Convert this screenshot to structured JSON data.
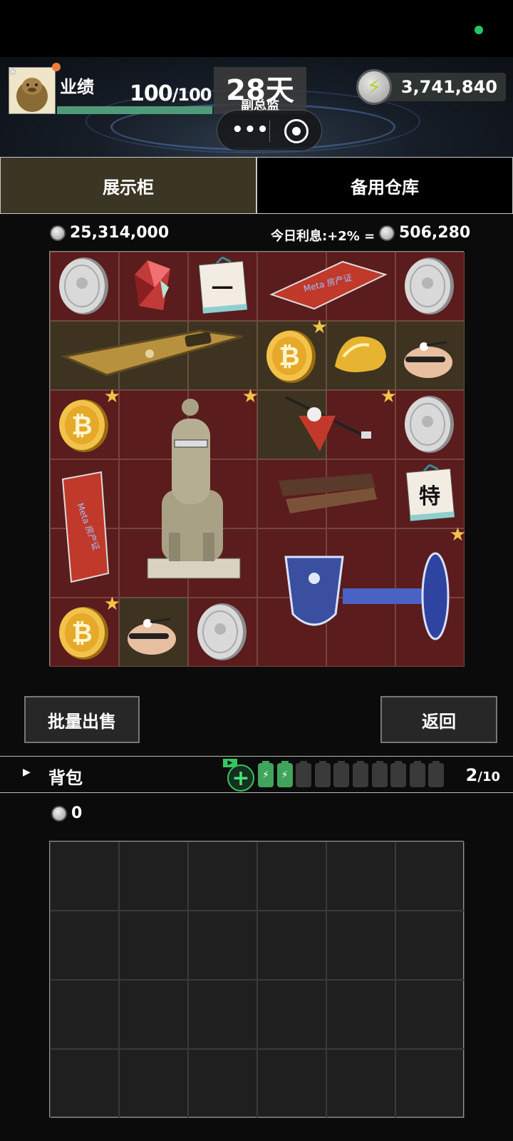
{
  "player": {
    "performance_label": "业绩",
    "performance_value": "100",
    "performance_max": "/100",
    "performance_fraction": 1.0,
    "days": "28天",
    "rank": "副总监",
    "money": "3,741,840"
  },
  "tabs": [
    {
      "label": "展示柜",
      "active": true
    },
    {
      "label": "备用仓库",
      "active": false
    }
  ],
  "showcase": {
    "total_value": "25,314,000",
    "interest_label": "今日利息:+2% =",
    "interest_value": "506,280"
  },
  "items": [
    {
      "name": "silver-coin",
      "label": "",
      "starred": false
    },
    {
      "name": "red-gem",
      "label": "",
      "starred": false
    },
    {
      "name": "notice-card",
      "label": "一",
      "starred": false
    },
    {
      "name": "meta-property-card",
      "label": "Meta 房产证",
      "starred": false
    },
    {
      "name": "silver-coin",
      "label": "",
      "starred": false
    },
    {
      "name": "gold-phone",
      "label": "",
      "starred": false
    },
    {
      "name": "bitcoin",
      "label": "₿",
      "starred": true
    },
    {
      "name": "gold-nugget",
      "label": "",
      "starred": false
    },
    {
      "name": "capsule-robot",
      "label": "",
      "starred": false
    },
    {
      "name": "bitcoin",
      "label": "₿",
      "starred": true
    },
    {
      "name": "alpaca-statue",
      "label": "",
      "starred": true
    },
    {
      "name": "red-spinning-top",
      "label": "",
      "starred": true
    },
    {
      "name": "silver-coin",
      "label": "",
      "starred": false
    },
    {
      "name": "meta-property-card",
      "label": "Meta 房产证",
      "starred": false
    },
    {
      "name": "wooden-ruler",
      "label": "",
      "starred": false
    },
    {
      "name": "special-card",
      "label": "特",
      "starred": false
    },
    {
      "name": "crystal-goblet",
      "label": "",
      "starred": true
    },
    {
      "name": "bitcoin",
      "label": "₿",
      "starred": true
    },
    {
      "name": "capsule-robot",
      "label": "",
      "starred": false
    },
    {
      "name": "silver-coin",
      "label": "",
      "starred": false
    }
  ],
  "buttons": {
    "bulk_sell": "批量出售",
    "back": "返回"
  },
  "backpack": {
    "title": "背包",
    "count": "2",
    "capacity": "/10",
    "slots_filled": 2,
    "slots_total": 10,
    "money": "0"
  },
  "colors": {
    "tab_active": "#3b3524",
    "cell_red": "#5a1c1c",
    "cell_gold": "#3d3320",
    "star": "#f2c24a",
    "accent_green": "#35c65f"
  }
}
